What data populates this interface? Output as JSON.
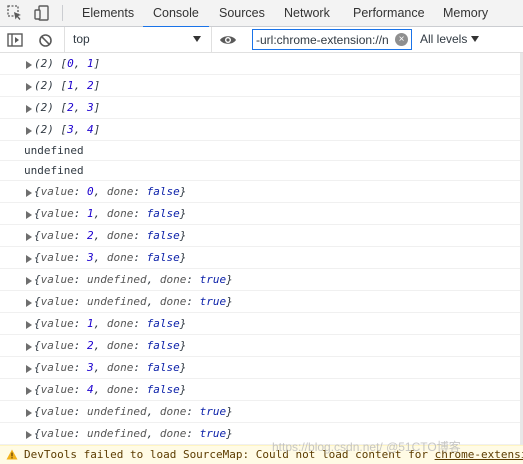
{
  "tabs": [
    "Elements",
    "Console",
    "Sources",
    "Network",
    "Performance",
    "Memory"
  ],
  "active_tab": "Console",
  "toolbar": {
    "context": "top",
    "filter_value": "-url:chrome-extension://n",
    "levels": "All levels"
  },
  "icons": {
    "inspect": "element-picker-icon",
    "device": "device-toolbar-icon",
    "sidebar": "show-sidebar-icon",
    "clear": "clear-console-icon",
    "eye": "live-expression-icon",
    "warning": "warning-icon"
  },
  "colors": {
    "accent": "#1a73e8",
    "number": "#1c00cf",
    "keyword": "#0d22aa",
    "warning_bg": "#fffbe5"
  },
  "messages": [
    {
      "kind": "array",
      "len": "(2)",
      "a": "0",
      "b": "1"
    },
    {
      "kind": "array",
      "len": "(2)",
      "a": "1",
      "b": "2"
    },
    {
      "kind": "array",
      "len": "(2)",
      "a": "2",
      "b": "3"
    },
    {
      "kind": "array",
      "len": "(2)",
      "a": "3",
      "b": "4"
    },
    {
      "kind": "plain",
      "text": "undefined"
    },
    {
      "kind": "plain",
      "text": "undefined"
    },
    {
      "kind": "obj",
      "value": "0",
      "done": "false"
    },
    {
      "kind": "obj",
      "value": "1",
      "done": "false"
    },
    {
      "kind": "obj",
      "value": "2",
      "done": "false"
    },
    {
      "kind": "obj",
      "value": "3",
      "done": "false"
    },
    {
      "kind": "obj",
      "value": "undefined",
      "done": "true"
    },
    {
      "kind": "obj",
      "value": "undefined",
      "done": "true"
    },
    {
      "kind": "obj",
      "value": "1",
      "done": "false"
    },
    {
      "kind": "obj",
      "value": "2",
      "done": "false"
    },
    {
      "kind": "obj",
      "value": "3",
      "done": "false"
    },
    {
      "kind": "obj",
      "value": "4",
      "done": "false"
    },
    {
      "kind": "obj",
      "value": "undefined",
      "done": "true"
    },
    {
      "kind": "obj",
      "value": "undefined",
      "done": "true"
    }
  ],
  "warning": {
    "text": "DevTools failed to load SourceMap: Could not load content for ",
    "link": "chrome-extensi"
  },
  "watermark": "https://blog.csdn.net/  @51CTO博客"
}
